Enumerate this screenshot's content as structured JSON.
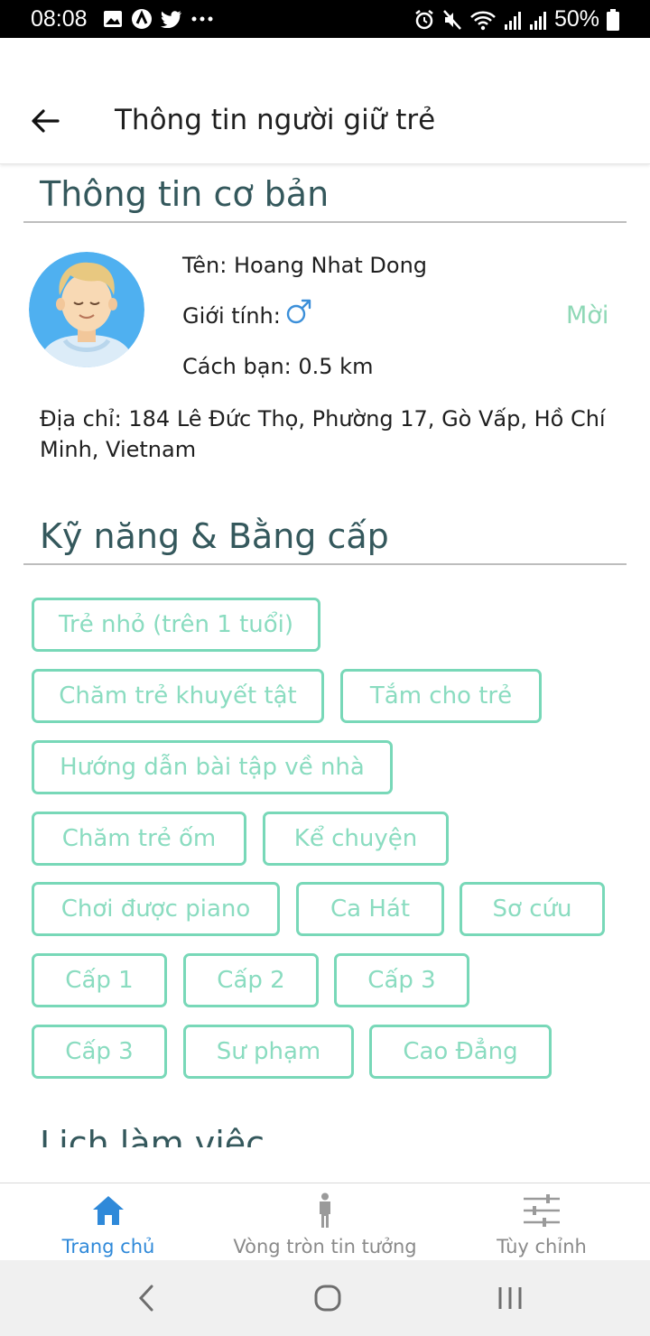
{
  "status_bar": {
    "time": "08:08",
    "battery": "50%"
  },
  "header": {
    "title": "Thông tin người giữ trẻ",
    "back_icon": "arrow-left-icon"
  },
  "basic_info": {
    "section_title": "Thông tin cơ bản",
    "name": "Tên: Hoang Nhat Dong",
    "gender_label": "Giới tính:",
    "gender_icon": "male-symbol-icon",
    "distance": "Cách bạn: 0.5 km",
    "invite_label": "Mời",
    "address": "Địa chỉ: 184 Lê Đức Thọ, Phường 17, Gò Vấp, Hồ Chí Minh, Vietnam"
  },
  "skills": {
    "section_title": "Kỹ năng & Bằng cấp",
    "chips": [
      "Trẻ nhỏ (trên 1 tuổi)",
      "Chăm trẻ khuyết tật",
      "Tắm cho trẻ",
      "Hướng dẫn bài tập về nhà",
      "Chăm trẻ ốm",
      "Kể chuyện",
      "Chơi được piano",
      "Ca Hát",
      "Sơ cứu",
      "Cấp 1",
      "Cấp 2",
      "Cấp 3",
      "Cấp 3",
      "Sư phạm",
      "Cao Đẳng"
    ]
  },
  "schedule": {
    "section_title": "Lịch làm việc"
  },
  "bottom_nav": {
    "items": [
      {
        "label": "Trang chủ",
        "icon": "home-icon",
        "active": true
      },
      {
        "label": "Vòng tròn tin tưởng",
        "icon": "person-icon",
        "active": false
      },
      {
        "label": "Tùy chỉnh",
        "icon": "sliders-icon",
        "active": false
      }
    ]
  },
  "colors": {
    "accent_teal": "#78d8b8",
    "section_title": "#34585c",
    "nav_active": "#2f89d9"
  }
}
